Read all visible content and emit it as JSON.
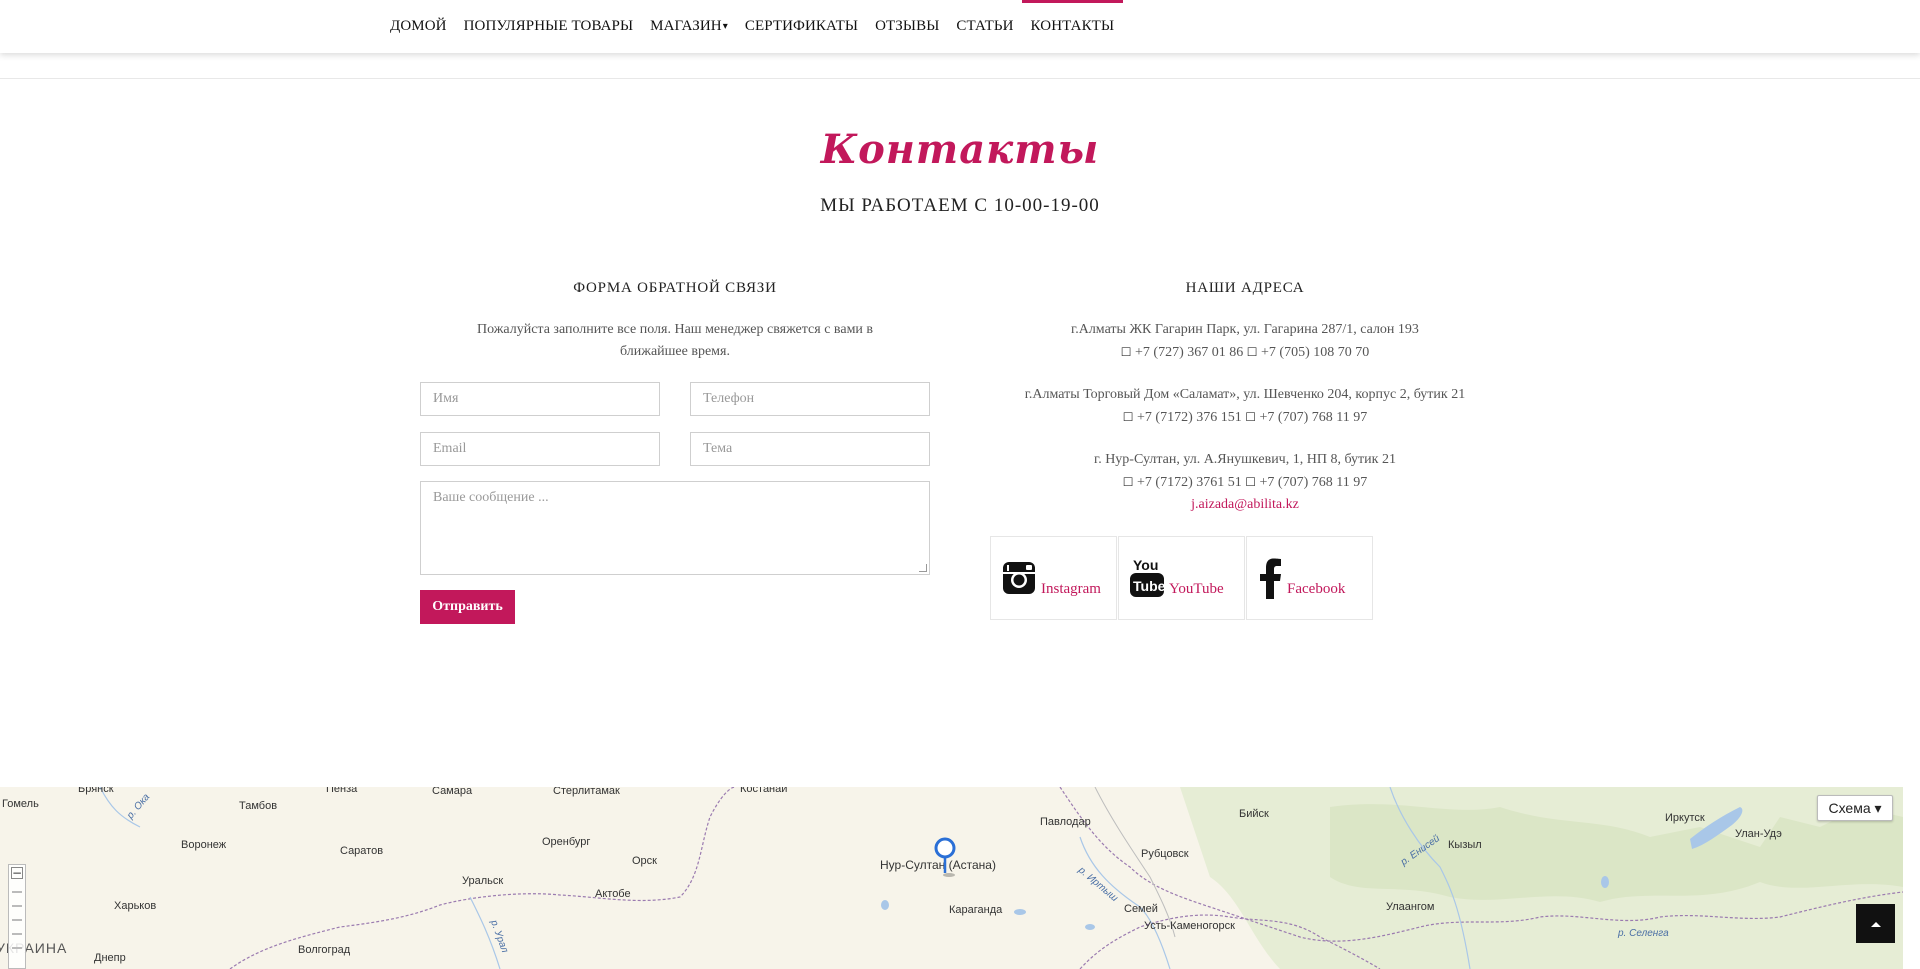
{
  "nav": {
    "items": [
      {
        "label": "ДОМОЙ"
      },
      {
        "label": "ПОПУЛЯРНЫЕ ТОВАРЫ"
      },
      {
        "label": "МАГАЗИН"
      },
      {
        "label": "СЕРТИФИКАТЫ"
      },
      {
        "label": "ОТЗЫВЫ"
      },
      {
        "label": "СТАТЬИ"
      },
      {
        "label": "КОНТАКТЫ"
      }
    ],
    "active": "КОНТАКТЫ"
  },
  "page": {
    "title": "Контакты",
    "hours": "МЫ РАБОТАЕМ С 10-00-19-00"
  },
  "form": {
    "title": "ФОРМА ОБРАТНОЙ СВЯЗИ",
    "intro": "Пожалуйста заполните все поля. Наш менеджер свяжется с вами в ближайшее время.",
    "name_placeholder": "Имя",
    "phone_placeholder": "Телефон",
    "email_placeholder": "Email",
    "subject_placeholder": "Тема",
    "message_placeholder": "Ваше сообщение ...",
    "submit_label": "Отправить"
  },
  "addresses": {
    "title": "НАШИ АДРЕСА",
    "items": [
      {
        "address": "г.Алматы ЖК Гагарин Парк, ул. Гагарина 287/1, салон 193",
        "phone1": "+7 (727) 367 01 86",
        "phone2": "+7 (705) 108 70 70"
      },
      {
        "address": "г.Алматы Торговый Дом «Саламат», ул. Шевченко 204, корпус 2, бутик 21",
        "phone1": "+7 (7172) 376 151",
        "phone2": "+7 (707) 768 11 97"
      },
      {
        "address": "г. Нур-Султан, ул. А.Янушкевич, 1, НП 8, бутик 21",
        "phone1": "+7 (7172) 3761 51",
        "phone2": "+7 (707) 768 11 97"
      }
    ],
    "email": "j.aizada@abilita.kz"
  },
  "socials": [
    {
      "label": "Instagram",
      "icon": "instagram-icon"
    },
    {
      "label": "YouTube",
      "icon": "youtube-icon"
    },
    {
      "label": "Facebook",
      "icon": "facebook-icon"
    }
  ],
  "map": {
    "layer_button": "Схема ▾",
    "marker_city": "Нур-Султан (Астана)",
    "cities": [
      "Брянск",
      "Пенза",
      "Самара",
      "Стерлитамак",
      "Костанай",
      "Бийск",
      "Тамбов",
      "Воронеж",
      "Саратов",
      "Оренбург",
      "Павлодар",
      "Рубцовск",
      "Кызыл",
      "Иркутск",
      "Улан-Удэ",
      "Орск",
      "Уральск",
      "Актобе",
      "Харьков",
      "Караганда",
      "Семей",
      "Усть-Каменогорск",
      "Улаангом",
      "Волгоград",
      "Днепр",
      "Гомель"
    ],
    "rivers": [
      "р. Ока",
      "р. Урал",
      "р. Иртыш",
      "р. Енисей",
      "р. Селенга"
    ],
    "country": "УКРАИНА",
    "accent": "#c2185b"
  },
  "colors": {
    "accent": "#c2185b",
    "text": "#333333"
  }
}
